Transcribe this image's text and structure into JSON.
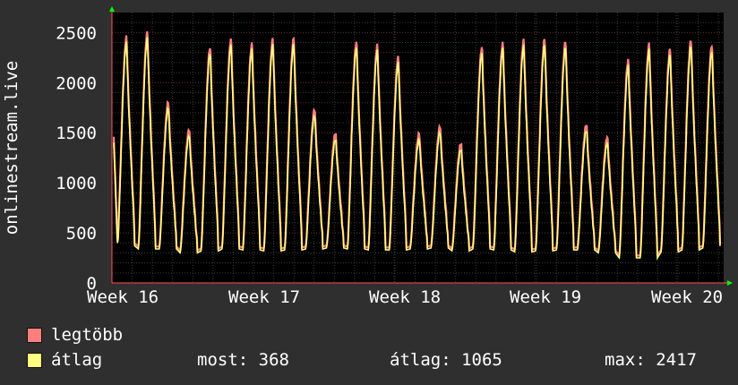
{
  "chart_data": {
    "type": "line",
    "ylabel": "onlinestream.live",
    "x_ticks": [
      "Week 16",
      "Week 17",
      "Week 18",
      "Week 19",
      "Week 20"
    ],
    "ylim": [
      0,
      2700
    ],
    "y_ticks": [
      0,
      500,
      1000,
      1500,
      2000,
      2500
    ],
    "grid": true,
    "daily_peaks_avg": [
      2400,
      2450,
      1750,
      1480,
      2300,
      2380,
      2330,
      2380,
      2390,
      1680,
      1440,
      2350,
      2320,
      2200,
      1440,
      1510,
      1340,
      2300,
      2340,
      2370,
      2380,
      2360,
      1530,
      1400,
      2170,
      2330,
      2280,
      2370,
      2320
    ],
    "daily_minimums": [
      370,
      340,
      340,
      300,
      320,
      340,
      330,
      320,
      330,
      340,
      350,
      340,
      330,
      330,
      340,
      350,
      320,
      340,
      330,
      310,
      320,
      330,
      330,
      300,
      250,
      250,
      310,
      330,
      350
    ],
    "max_offset": 60,
    "start_value": 1400,
    "end_value": 368,
    "series": [
      {
        "name": "legtöbb",
        "color": "#ff7f7f"
      },
      {
        "name": "átlag",
        "color": "#ffff80"
      }
    ]
  },
  "legend": {
    "max_label": "legtöbb",
    "avg_label": "átlag",
    "now_text": "most: 368",
    "avg_text": "átlag: 1065",
    "max_text": "max: 2417"
  },
  "colors": {
    "background": "#2f2f2f",
    "plot_background": "#000000",
    "grid_major": "#5a2a2a",
    "grid_minor": "#3a3a3a",
    "axis": "#ff5050",
    "text": "#ffffff",
    "arrow": "#00ff00"
  }
}
